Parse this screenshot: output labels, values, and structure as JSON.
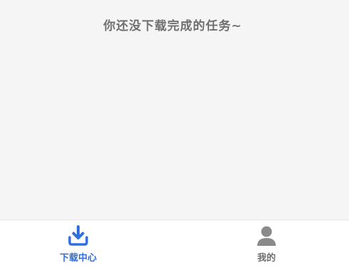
{
  "empty_state": {
    "message": "你还没下载完成的任务~"
  },
  "tabbar": {
    "tabs": [
      {
        "label": "下载中心",
        "icon": "download-icon",
        "active": true
      },
      {
        "label": "我的",
        "icon": "person-icon",
        "active": false
      }
    ]
  },
  "colors": {
    "active": "#2f6fe0",
    "inactive": "#8a8a8a",
    "background": "#f5f5f5"
  }
}
